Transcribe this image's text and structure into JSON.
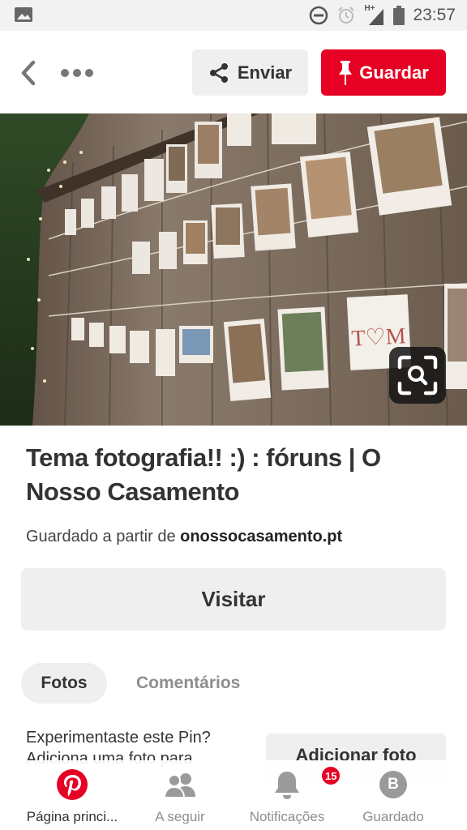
{
  "status_bar": {
    "time": "23:57",
    "network_label": "H+",
    "icons": [
      "image-icon",
      "do-not-disturb-icon",
      "alarm-icon",
      "signal-icon",
      "battery-icon"
    ]
  },
  "topbar": {
    "back_icon": "chevron-left-icon",
    "more_icon": "more-dots-icon",
    "send_label": "Enviar",
    "save_label": "Guardar"
  },
  "pin": {
    "title": "Tema fotografia!! :) : fóruns | O Nosso Casamento",
    "saved_from_prefix": "Guardado a partir de",
    "saved_from_domain": "onossocasamento.pt",
    "photo_card_text": "T♡M",
    "visit_label": "Visitar"
  },
  "tabs": {
    "photos": "Fotos",
    "comments": "Comentários"
  },
  "tried": {
    "text": "Experimentaste este Pin? Adiciona uma foto para",
    "add_photo_label": "Adicionar foto"
  },
  "bottom_nav": {
    "items": [
      {
        "label": "Página princi...",
        "icon": "pinterest-logo-icon"
      },
      {
        "label": "A seguir",
        "icon": "people-icon"
      },
      {
        "label": "Notificações",
        "icon": "bell-icon",
        "badge": "15"
      },
      {
        "label": "Guardado",
        "icon": "profile-initial-icon",
        "initial": "B"
      }
    ]
  },
  "colors": {
    "brand_red": "#e60023",
    "button_gray": "#efefef",
    "text_dark": "#333333",
    "text_muted": "#8e8e8e"
  }
}
